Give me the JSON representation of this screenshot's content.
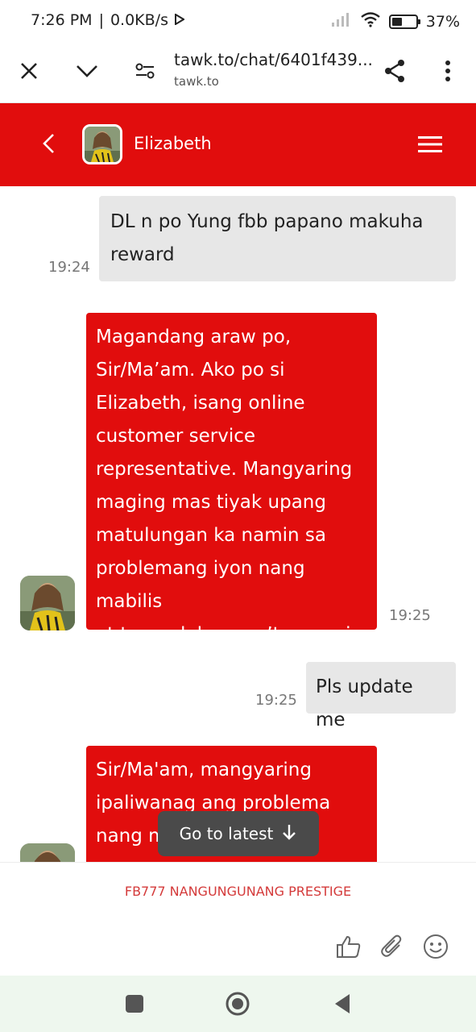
{
  "status": {
    "time": "7:26 PM",
    "speed": "0.0KB/s",
    "battery": "37%"
  },
  "browser": {
    "url": "tawk.to/chat/6401f439...",
    "domain": "tawk.to"
  },
  "header": {
    "agent_name": "Elizabeth",
    "accent": "#e10d0d"
  },
  "messages": [
    {
      "from": "user",
      "lines": [
        "DL n po Yung fbb papano makuha",
        "reward"
      ],
      "time": "19:24"
    },
    {
      "from": "agent",
      "lines": [
        "Magandang araw po,",
        "Sir/Ma’am. Ako po si",
        "Elizabeth, isang online",
        "customer service",
        "representative. Mangyaring",
        "maging mas tiyak upang",
        "matulungan ka namin sa",
        "problemang iyon nang mabilis",
        "at tumpak hangga’t maaari."
      ],
      "time": "19:25"
    },
    {
      "from": "user",
      "lines": [
        "Pls update me"
      ],
      "time": "19:25"
    },
    {
      "from": "agent",
      "lines": [
        "Sir/Ma'am, mangyaring",
        "ipaliwanag ang problema",
        "nang m                    ng"
      ],
      "time": ""
    }
  ],
  "go_latest_label": "Go to latest",
  "footer": {
    "brand": "FB777 NANGUNGUNANG PRESTIGE",
    "icons": [
      "thumbs-up-icon",
      "paperclip-icon",
      "emoji-icon"
    ]
  }
}
